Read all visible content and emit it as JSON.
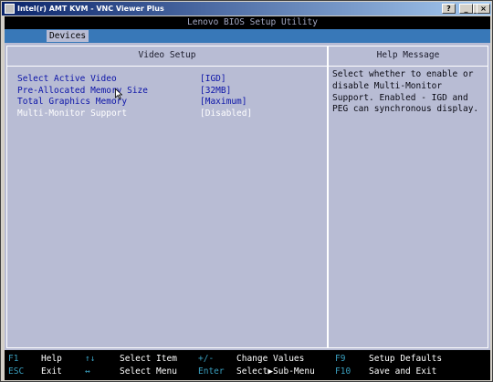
{
  "window": {
    "title": "Intel(r) AMT KVM - VNC Viewer Plus",
    "buttons": {
      "help": "?",
      "minimize": "_",
      "maximize": "□",
      "close": "×"
    }
  },
  "bios": {
    "title": "Lenovo BIOS Setup Utility",
    "active_tab": "Devices",
    "section_title": "Video Setup",
    "help_title": "Help Message",
    "help_text": "Select whether to enable or disable Multi-Monitor Support. Enabled - IGD and PEG can synchronous display.",
    "settings": [
      {
        "label": "Select Active Video",
        "value": "[IGD]"
      },
      {
        "label": "Pre-Allocated Memory Size",
        "value": "[32MB]"
      },
      {
        "label": "Total Graphics Memory",
        "value": "[Maximum]"
      },
      {
        "label": "Multi-Monitor Support",
        "value": "[Disabled]"
      }
    ],
    "selected_setting": "Multi-Monitor Support"
  },
  "footer": {
    "row1": [
      {
        "key": "F1",
        "desc": "Help"
      },
      {
        "key": "↑↓",
        "desc": "Select Item"
      },
      {
        "key": "+/-",
        "desc": "Change Values"
      },
      {
        "key": "F9",
        "desc": "Setup Defaults"
      }
    ],
    "row2": [
      {
        "key": "ESC",
        "desc": "Exit"
      },
      {
        "key": "↔",
        "desc": "Select Menu"
      },
      {
        "key": "Enter",
        "desc": "Select▶Sub-Menu"
      },
      {
        "key": "F10",
        "desc": "Save and Exit"
      }
    ]
  },
  "colors": {
    "bios_background": "#b8bcd4",
    "tab_bar": "#3878b8",
    "setting_text": "#0c14a8",
    "selected_text": "#ffffff",
    "footer_key": "#3aa0c0"
  }
}
